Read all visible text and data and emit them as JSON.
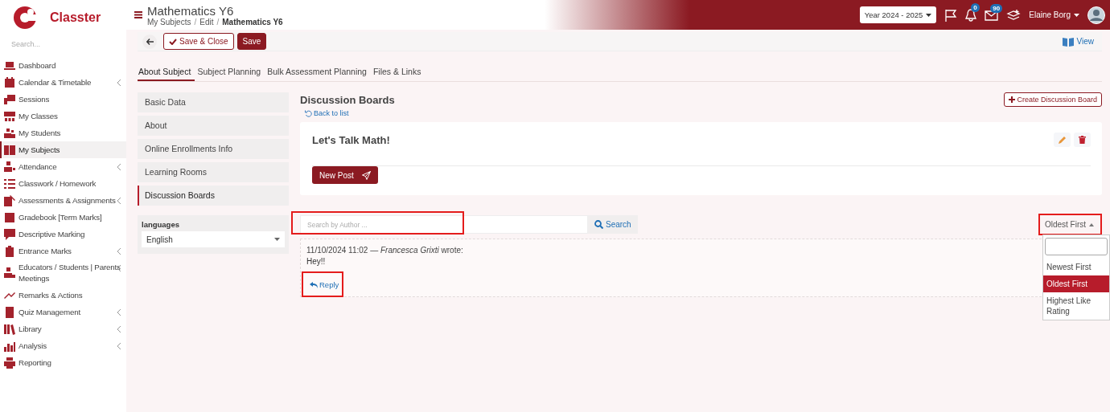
{
  "brand": {
    "name": "Classter"
  },
  "sidebar": {
    "search": {
      "placeholder": "Search..."
    },
    "items": [
      {
        "label": "Dashboard",
        "selected": false,
        "has_submenu": false
      },
      {
        "label": "Calendar & Timetable",
        "selected": false,
        "has_submenu": true
      },
      {
        "label": "Sessions",
        "selected": false,
        "has_submenu": false
      },
      {
        "label": "My Classes",
        "selected": false,
        "has_submenu": false
      },
      {
        "label": "My Students",
        "selected": false,
        "has_submenu": false
      },
      {
        "label": "My Subjects",
        "selected": true,
        "has_submenu": false
      },
      {
        "label": "Attendance",
        "selected": false,
        "has_submenu": true
      },
      {
        "label": "Classwork / Homework",
        "selected": false,
        "has_submenu": false
      },
      {
        "label": "Assessments & Assignments",
        "selected": false,
        "has_submenu": true
      },
      {
        "label": "Gradebook [Term Marks]",
        "selected": false,
        "has_submenu": false
      },
      {
        "label": "Descriptive Marking",
        "selected": false,
        "has_submenu": false
      },
      {
        "label": "Entrance Marks",
        "selected": false,
        "has_submenu": true
      },
      {
        "label": "Educators / Students | Parents Meetings",
        "selected": false,
        "has_submenu": true
      },
      {
        "label": "Remarks & Actions",
        "selected": false,
        "has_submenu": false
      },
      {
        "label": "Quiz Management",
        "selected": false,
        "has_submenu": true
      },
      {
        "label": "Library",
        "selected": false,
        "has_submenu": true
      },
      {
        "label": "Analysis",
        "selected": false,
        "has_submenu": true
      },
      {
        "label": "Reporting",
        "selected": false,
        "has_submenu": false
      }
    ]
  },
  "header": {
    "title": "Mathematics Y6",
    "breadcrumb_separator": "/",
    "breadcrumb": [
      {
        "label": "My Subjects",
        "current": false
      },
      {
        "label": "Edit",
        "current": false
      },
      {
        "label": "Mathematics Y6",
        "current": true
      }
    ],
    "year_selector": "Year 2024 - 2025",
    "notifications_badge": "0",
    "messages_badge": "90",
    "user": "Elaine Borg"
  },
  "toolbar": {
    "buttons": [
      {
        "label": "Save & Close",
        "kind": "outline"
      },
      {
        "label": "Save",
        "kind": "primary"
      }
    ],
    "view_link": "View"
  },
  "tabs": [
    {
      "label": "About Subject",
      "selected": true
    },
    {
      "label": "Subject Planning",
      "selected": false
    },
    {
      "label": "Bulk Assessment Planning",
      "selected": false
    },
    {
      "label": "Files & Links",
      "selected": false
    }
  ],
  "subject_menu": [
    {
      "label": "Basic Data",
      "selected": false
    },
    {
      "label": "About",
      "selected": false
    },
    {
      "label": "Online Enrollments Info",
      "selected": false
    },
    {
      "label": "Learning Rooms",
      "selected": false
    },
    {
      "label": "Discussion Boards",
      "selected": true
    }
  ],
  "languages": {
    "label": "languages",
    "value": "English"
  },
  "board": {
    "heading": "Discussion Boards",
    "create_button": "Create Discussion Board",
    "back_link": "Back to list",
    "title": "Let's Talk Math!",
    "new_post_button": "New Post"
  },
  "search": {
    "placeholder": "Search by Author ...",
    "button": "Search",
    "highlighted": true
  },
  "sort": {
    "value": "Oldest First",
    "highlighted": true,
    "expanded": true,
    "options": [
      {
        "label": "Newest First",
        "selected": false
      },
      {
        "label": "Oldest First",
        "selected": true
      },
      {
        "label": "Highest Like Rating",
        "selected": false
      }
    ]
  },
  "posts": [
    {
      "meta": "11/10/2024 11:02 — *Francesca Grixti* wrote:",
      "body": "Hey!!",
      "reply": "Reply",
      "reply_highlighted": true
    }
  ]
}
